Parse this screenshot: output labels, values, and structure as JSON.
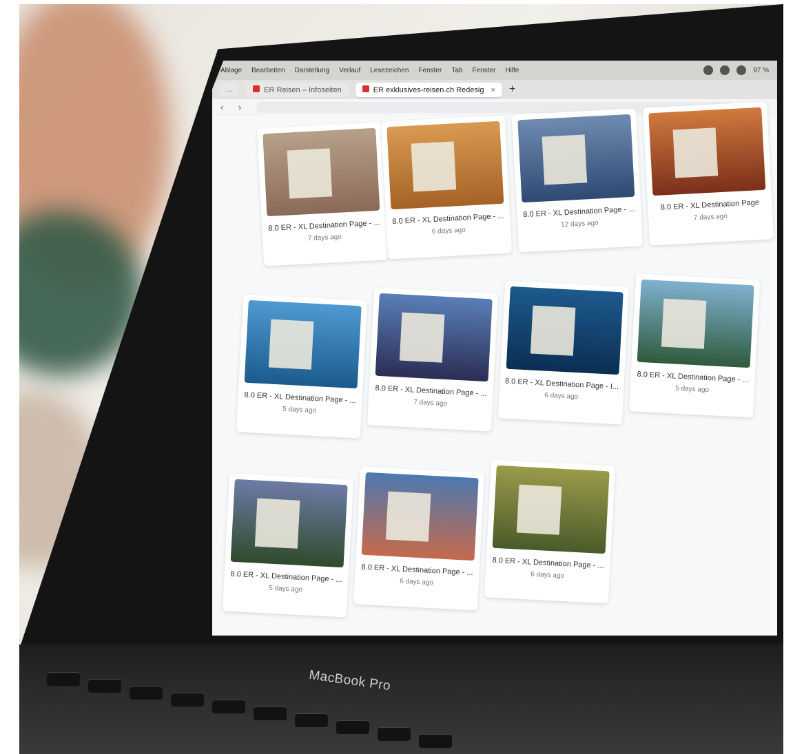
{
  "system_bar": {
    "menu_items": [
      "Ablage",
      "Bearbeiten",
      "Darstellung",
      "Verlauf",
      "Lesezeichen",
      "Fenster",
      "Tab",
      "Fenster",
      "Hilfe"
    ],
    "battery": "97 %"
  },
  "browser": {
    "tabs": [
      {
        "label": "...",
        "active": false
      },
      {
        "label": "ER Reisen – Infoseiten",
        "active": false
      },
      {
        "label": "ER exklusives-reisen.ch Redesig",
        "active": true
      }
    ],
    "new_tab": "+",
    "search_icon": "search-icon",
    "star_icon": "star-icon"
  },
  "cards": [
    {
      "title": "8.0 ER - XL Destination Page - ...",
      "meta": "7 days ago"
    },
    {
      "title": "8.0 ER - XL Destination Page - ...",
      "meta": "6 days ago"
    },
    {
      "title": "8.0 ER - XL Destination Page - ...",
      "meta": "12 days ago"
    },
    {
      "title": "8.0 ER - XL Destination Page",
      "meta": "7 days ago"
    },
    {
      "title": "8.0 ER - XL Destination Page - ...",
      "meta": "5 days ago"
    },
    {
      "title": "8.0 ER - XL Destination Page - ...",
      "meta": "7 days ago"
    },
    {
      "title": "8.0 ER - XL Destination Page - I...",
      "meta": "6 days ago"
    },
    {
      "title": "8.0 ER - XL Destination Page - ...",
      "meta": "5 days ago"
    },
    {
      "title": "8.0 ER - XL Destination Page - ...",
      "meta": "5 days ago"
    },
    {
      "title": "8.0 ER - XL Destination Page - ...",
      "meta": "6 days ago"
    },
    {
      "title": "8.0 ER - XL Destination Page - ...",
      "meta": "6 days ago"
    }
  ],
  "branding": {
    "laptop_label": "MacBook Pro"
  }
}
